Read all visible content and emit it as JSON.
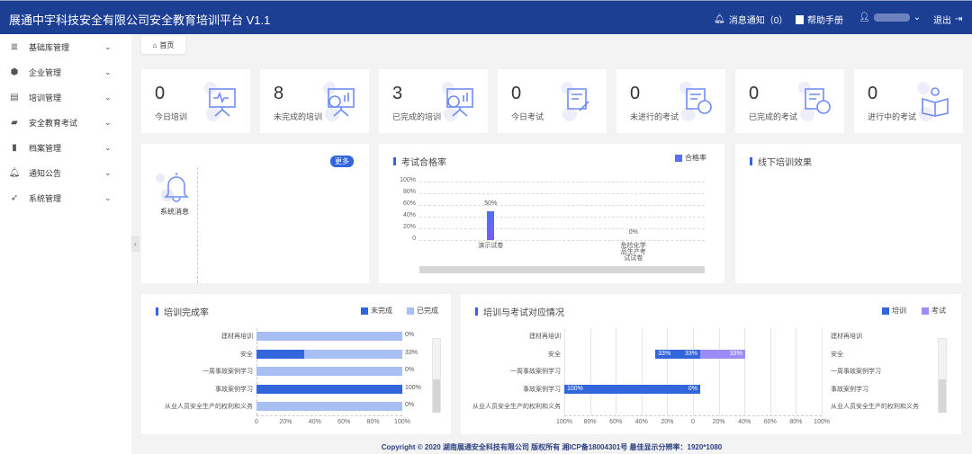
{
  "header": {
    "title": "展通中宇科技安全有限公司安全教育培训平台 V1.1",
    "notify": "消息通知（0）",
    "help": "帮助手册",
    "logout": "退出"
  },
  "sidebar": {
    "items": [
      {
        "label": "基础库管理",
        "icon": "database-icon"
      },
      {
        "label": "企业管理",
        "icon": "enterprise-icon"
      },
      {
        "label": "培训管理",
        "icon": "training-icon"
      },
      {
        "label": "安全教育考试",
        "icon": "exam-book-icon"
      },
      {
        "label": "档案管理",
        "icon": "file-icon"
      },
      {
        "label": "通知公告",
        "icon": "bell-icon"
      },
      {
        "label": "系统管理",
        "icon": "rocket-icon"
      }
    ]
  },
  "breadcrumb": {
    "home": "首页"
  },
  "stats": [
    {
      "value": "0",
      "label": "今日培训"
    },
    {
      "value": "8",
      "label": "未完成的培训"
    },
    {
      "value": "3",
      "label": "已完成的培训"
    },
    {
      "value": "0",
      "label": "今日考试"
    },
    {
      "value": "0",
      "label": "未进行的考试"
    },
    {
      "value": "0",
      "label": "已完成的考试"
    },
    {
      "value": "0",
      "label": "进行中的考试"
    }
  ],
  "messages": {
    "more": "更多",
    "label": "系统消息"
  },
  "offline": {
    "title": "线下培训效果"
  },
  "colors": {
    "header": "#1c3f94",
    "primary": "#3366dd",
    "light": "#a8bff3",
    "exam": "#9b8cf7"
  },
  "chart_data": [
    {
      "type": "bar",
      "title": "考试合格率",
      "legend": [
        "合格率"
      ],
      "categories": [
        "演示试卷",
        "危险化学品生产考试试卷"
      ],
      "category_lines": [
        [
          "演示试卷"
        ],
        [
          "危险化学",
          "品生产考",
          "试试卷"
        ]
      ],
      "values": [
        50,
        0
      ],
      "value_labels": [
        "50%",
        "0%"
      ],
      "yticks": [
        "100%",
        "80%",
        "60%",
        "40%",
        "20%",
        "0"
      ],
      "ylim": [
        0,
        100
      ]
    },
    {
      "type": "bar",
      "orientation": "horizontal",
      "stacked": true,
      "title": "培训完成率",
      "legend": [
        "未完成",
        "已完成"
      ],
      "categories": [
        "建材再培训",
        "安全",
        "一周事故案例学习",
        "事故案例学习",
        "从业人员安全生产的权利和义务"
      ],
      "series": [
        {
          "name": "未完成",
          "values": [
            0,
            33,
            0,
            100,
            0
          ]
        },
        {
          "name": "已完成",
          "values": [
            100,
            67,
            100,
            0,
            100
          ]
        }
      ],
      "value_labels": [
        "0%",
        "33%",
        "0%",
        "100%",
        "0%"
      ],
      "xticks": [
        "0",
        "20%",
        "40%",
        "60%",
        "80%",
        "100%"
      ],
      "xlim": [
        0,
        100
      ]
    },
    {
      "type": "bar",
      "orientation": "horizontal",
      "diverging": true,
      "title": "培训与考试对应情况",
      "legend": [
        "培训",
        "考试"
      ],
      "categories": [
        "建材再培训",
        "安全",
        "一周事故案例学习",
        "事故案例学习",
        "从业人员安全生产的权利和义务"
      ],
      "series": [
        {
          "name": "培训",
          "values": [
            0,
            33,
            0,
            100,
            0
          ]
        },
        {
          "name": "考试",
          "values": [
            0,
            33,
            0,
            0,
            0
          ]
        }
      ],
      "xticks": [
        "100%",
        "80%",
        "60%",
        "40%",
        "20%",
        "0",
        "20%",
        "40%",
        "60%",
        "80%",
        "100%"
      ],
      "xlim": [
        -100,
        100
      ]
    }
  ],
  "footer": "Copyright © 2020 湖南展通安全科技有限公司 版权所有 湘ICP备18004301号 最佳显示分辨率：1920*1080"
}
